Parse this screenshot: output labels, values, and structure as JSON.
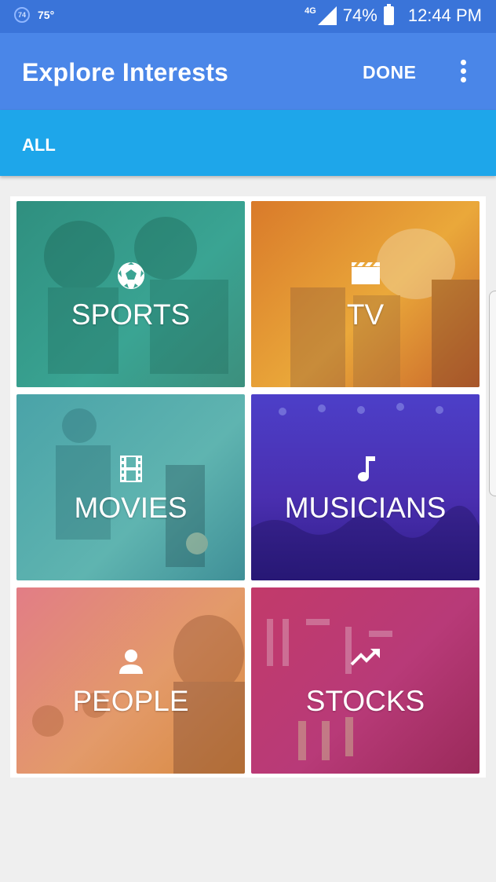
{
  "status_bar": {
    "temp_badge": "74",
    "temperature": "75°",
    "network": "4G",
    "battery": "74%",
    "time": "12:44 PM"
  },
  "app_bar": {
    "title": "Explore Interests",
    "done_label": "DONE",
    "more_icon": "more-vert-icon"
  },
  "tabs": {
    "all_label": "ALL"
  },
  "tiles": [
    {
      "label": "SPORTS",
      "icon": "soccer-ball-icon",
      "color": "#3a9a8a"
    },
    {
      "label": "TV",
      "icon": "clapperboard-icon",
      "color": "#e8a23a"
    },
    {
      "label": "MOVIES",
      "icon": "film-strip-icon",
      "color": "#4aa7a9"
    },
    {
      "label": "MUSICIANS",
      "icon": "music-note-icon",
      "color": "#4b2fb0"
    },
    {
      "label": "PEOPLE",
      "icon": "person-icon",
      "color": "#e0885a"
    },
    {
      "label": "STOCKS",
      "icon": "trending-up-icon",
      "color": "#b83a78"
    }
  ]
}
